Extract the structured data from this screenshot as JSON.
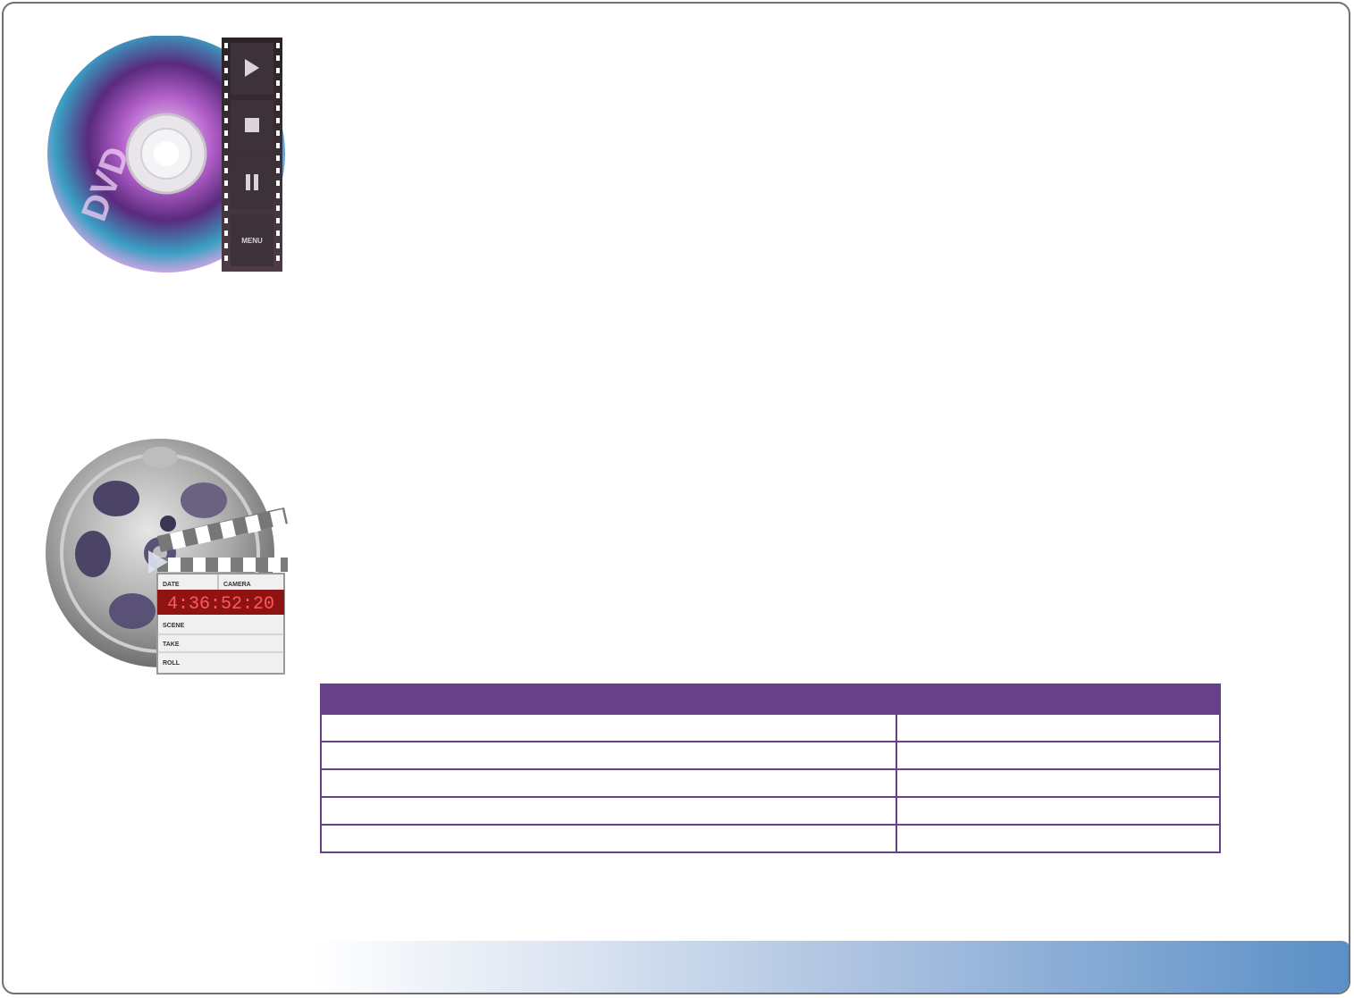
{
  "slide": {
    "icons": [
      "dvd-disc-icon",
      "film-reel-clapperboard-icon"
    ],
    "dvd_icon": {
      "disc_label": "DVD",
      "film_button_label": "MENU"
    },
    "reel_icon": {
      "clapper_fields": [
        "DATE",
        "CAMERA",
        "SCENE",
        "TAKE",
        "ROLL"
      ],
      "timecode": "4:36:52:20"
    },
    "table": {
      "headers": [
        "",
        ""
      ],
      "rows": [
        [
          "",
          ""
        ],
        [
          "",
          ""
        ],
        [
          "",
          ""
        ],
        [
          "",
          ""
        ],
        [
          "",
          ""
        ]
      ]
    },
    "colors": {
      "table_header": "#66418a",
      "footer_gradient_end": "#5a8fc6",
      "frame_border": "#707070"
    }
  }
}
